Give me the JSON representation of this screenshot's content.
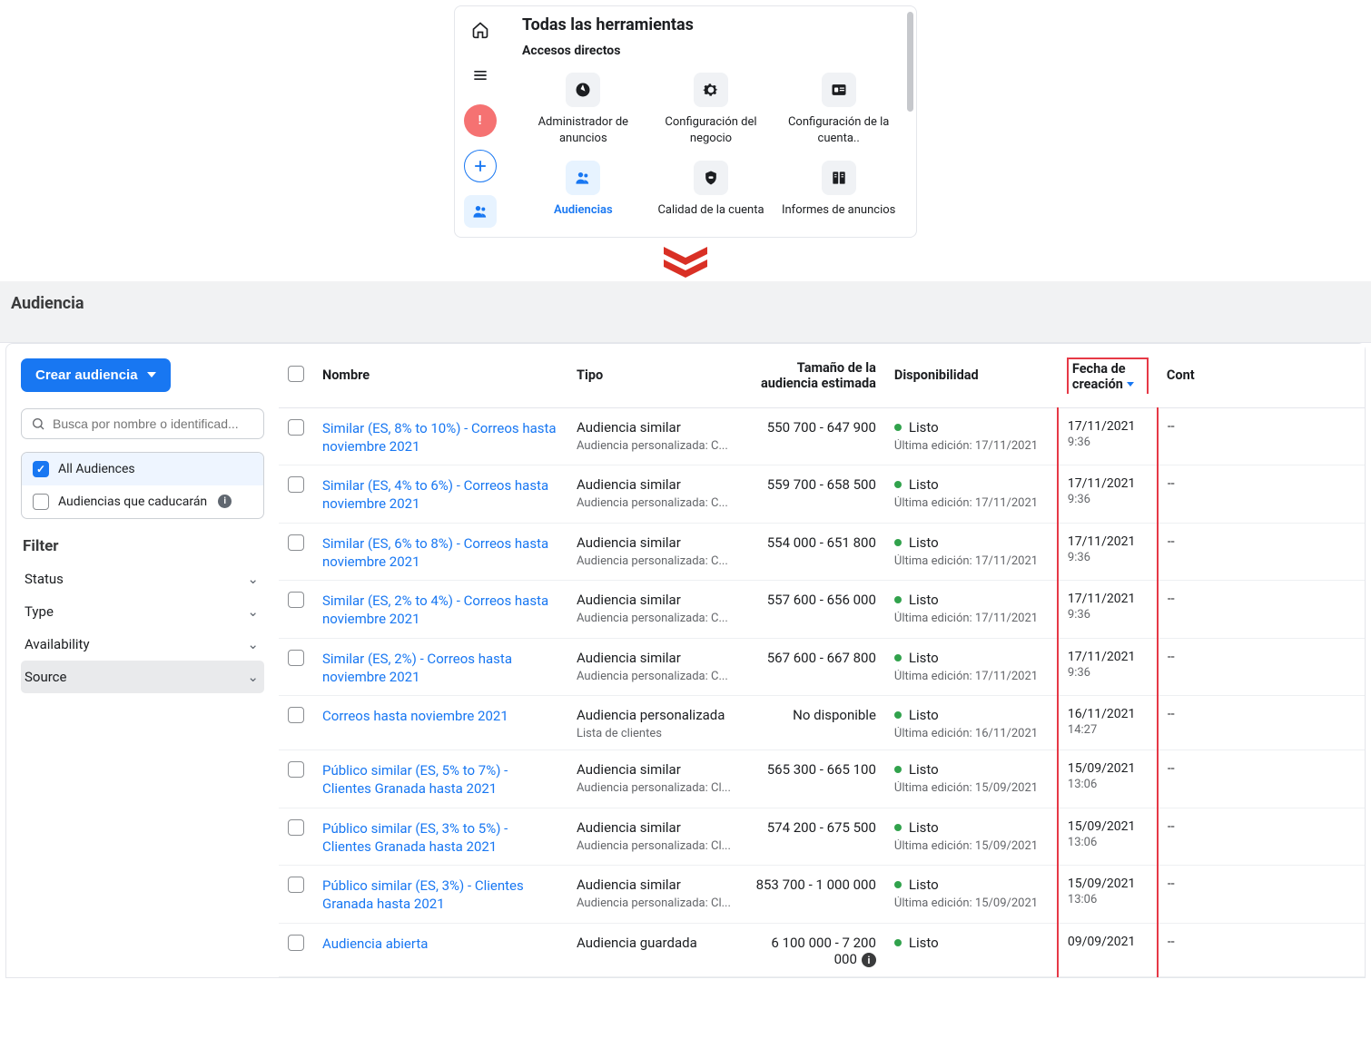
{
  "top": {
    "title": "Todas las herramientas",
    "subtitle": "Accesos directos",
    "shortcuts": [
      {
        "label": "Administrado​r de anuncios",
        "icon": "compass"
      },
      {
        "label": "Configuración del negocio",
        "icon": "gear"
      },
      {
        "label": "Configuración de la cuenta..",
        "icon": "id-card"
      },
      {
        "label": "Audiencias",
        "icon": "people",
        "active": true
      },
      {
        "label": "Calidad de la cuenta",
        "icon": "shield"
      },
      {
        "label": "Informes de anuncios",
        "icon": "reports"
      }
    ]
  },
  "page": {
    "title": "Audiencia",
    "create_btn": "Crear audiencia",
    "search_placeholder": "Busca por nombre o identificad...",
    "quick_filters": [
      {
        "label": "All Audiences",
        "selected": true
      },
      {
        "label": "Audiencias que caducarán",
        "info": true
      }
    ],
    "filter_title": "Filter",
    "filter_facets": [
      {
        "label": "Status"
      },
      {
        "label": "Type"
      },
      {
        "label": "Availability"
      },
      {
        "label": "Source",
        "hover": true
      }
    ],
    "columns": {
      "name": "Nombre",
      "type": "Tipo",
      "size": "Tamaño de la audiencia estimada",
      "avail": "Disponibilidad",
      "created": "Fecha de creación",
      "cont": "Cont"
    },
    "rows": [
      {
        "name": "Similar (ES, 8% to 10%) - Correos hasta noviembre 2021",
        "type": "Audiencia similar",
        "sub": "Audiencia personalizada: C...",
        "size": "550 700 - 647 900",
        "avail": "Listo",
        "edit": "Última edición: 17/11/2021",
        "date": "17/11/2021",
        "time": "9:36",
        "cont": "--"
      },
      {
        "name": "Similar (ES, 4% to 6%) - Correos hasta noviembre 2021",
        "type": "Audiencia similar",
        "sub": "Audiencia personalizada: C...",
        "size": "559 700 - 658 500",
        "avail": "Listo",
        "edit": "Última edición: 17/11/2021",
        "date": "17/11/2021",
        "time": "9:36",
        "cont": "--"
      },
      {
        "name": "Similar (ES, 6% to 8%) - Correos hasta noviembre 2021",
        "type": "Audiencia similar",
        "sub": "Audiencia personalizada: C...",
        "size": "554 000 - 651 800",
        "avail": "Listo",
        "edit": "Última edición: 17/11/2021",
        "date": "17/11/2021",
        "time": "9:36",
        "cont": "--"
      },
      {
        "name": "Similar (ES, 2% to 4%) - Correos hasta noviembre 2021",
        "type": "Audiencia similar",
        "sub": "Audiencia personalizada: C...",
        "size": "557 600 - 656 000",
        "avail": "Listo",
        "edit": "Última edición: 17/11/2021",
        "date": "17/11/2021",
        "time": "9:36",
        "cont": "--"
      },
      {
        "name": "Similar (ES, 2%) - Correos hasta noviembre 2021",
        "type": "Audiencia similar",
        "sub": "Audiencia personalizada: C...",
        "size": "567 600 - 667 800",
        "avail": "Listo",
        "edit": "Última edición: 17/11/2021",
        "date": "17/11/2021",
        "time": "9:36",
        "cont": "--"
      },
      {
        "name": "Correos hasta noviembre 2021",
        "type": "Audiencia personalizada",
        "sub": "Lista de clientes",
        "size": "No disponible",
        "avail": "Listo",
        "edit": "Última edición: 16/11/2021",
        "date": "16/11/2021",
        "time": "14:27",
        "cont": "--"
      },
      {
        "name": "Público similar (ES, 5% to 7%) - Clientes Granada hasta 2021",
        "type": "Audiencia similar",
        "sub": "Audiencia personalizada: Cl...",
        "size": "565 300 - 665 100",
        "avail": "Listo",
        "edit": "Última edición: 15/09/2021",
        "date": "15/09/2021",
        "time": "13:06",
        "cont": "--"
      },
      {
        "name": "Público similar (ES, 3% to 5%) - Clientes Granada hasta 2021",
        "type": "Audiencia similar",
        "sub": "Audiencia personalizada: Cl...",
        "size": "574 200 - 675 500",
        "avail": "Listo",
        "edit": "Última edición: 15/09/2021",
        "date": "15/09/2021",
        "time": "13:06",
        "cont": "--"
      },
      {
        "name": "Público similar (ES, 3%) - Clientes Granada hasta 2021",
        "type": "Audiencia similar",
        "sub": "Audiencia personalizada: Cl...",
        "size": "853 700 - 1 000 000",
        "avail": "Listo",
        "edit": "Última edición: 15/09/2021",
        "date": "15/09/2021",
        "time": "13:06",
        "cont": "--"
      },
      {
        "name": "Audiencia abierta",
        "type": "Audiencia guardada",
        "sub": "",
        "size": "6 100 000 - 7 200 000",
        "size_info": true,
        "avail": "Listo",
        "edit": "",
        "date": "09/09/2021",
        "time": "",
        "cont": "--"
      }
    ]
  }
}
